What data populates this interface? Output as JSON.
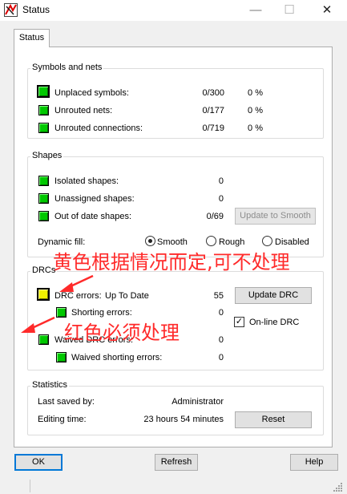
{
  "window": {
    "title": "Status",
    "minimize": "—",
    "maximize": "☐",
    "close": "✕"
  },
  "tab": {
    "label": "Status"
  },
  "symbols_nets": {
    "legend": "Symbols and nets",
    "rows": [
      {
        "label": "Unplaced symbols:",
        "value": "0/300",
        "percent": "0 %"
      },
      {
        "label": "Unrouted nets:",
        "value": "0/177",
        "percent": "0 %"
      },
      {
        "label": "Unrouted connections:",
        "value": "0/719",
        "percent": "0 %"
      }
    ]
  },
  "shapes": {
    "legend": "Shapes",
    "rows": [
      {
        "label": "Isolated shapes:",
        "value": "0"
      },
      {
        "label": "Unassigned shapes:",
        "value": "0"
      },
      {
        "label": "Out of date shapes:",
        "value": "0/69"
      }
    ],
    "update_button": "Update to Smooth",
    "dynamic_fill_label": "Dynamic fill:",
    "options": [
      "Smooth",
      "Rough",
      "Disabled"
    ],
    "selected": "Smooth"
  },
  "drcs": {
    "legend": "DRCs",
    "drc_errors_label": "DRC errors:",
    "drc_state": "Up To Date",
    "drc_errors_value": "55",
    "shorting_label": "Shorting errors:",
    "shorting_value": "0",
    "waived_label": "Waived DRC errors:",
    "waived_value": "0",
    "waived_shorting_label": "Waived shorting errors:",
    "waived_shorting_value": "0",
    "update_drc_button": "Update DRC",
    "online_drc_label": "On-line DRC",
    "online_drc_checked": true
  },
  "statistics": {
    "legend": "Statistics",
    "last_saved_label": "Last saved by:",
    "last_saved_value": "Administrator",
    "editing_label": "Editing time:",
    "editing_value": "23 hours 54 minutes",
    "reset_button": "Reset"
  },
  "buttons": {
    "ok": "OK",
    "refresh": "Refresh",
    "help": "Help"
  },
  "annotations": {
    "note_yellow": "黄色根据情况而定,可不处理",
    "note_red": "红色必须处理",
    "color": "#ff2a2a"
  }
}
